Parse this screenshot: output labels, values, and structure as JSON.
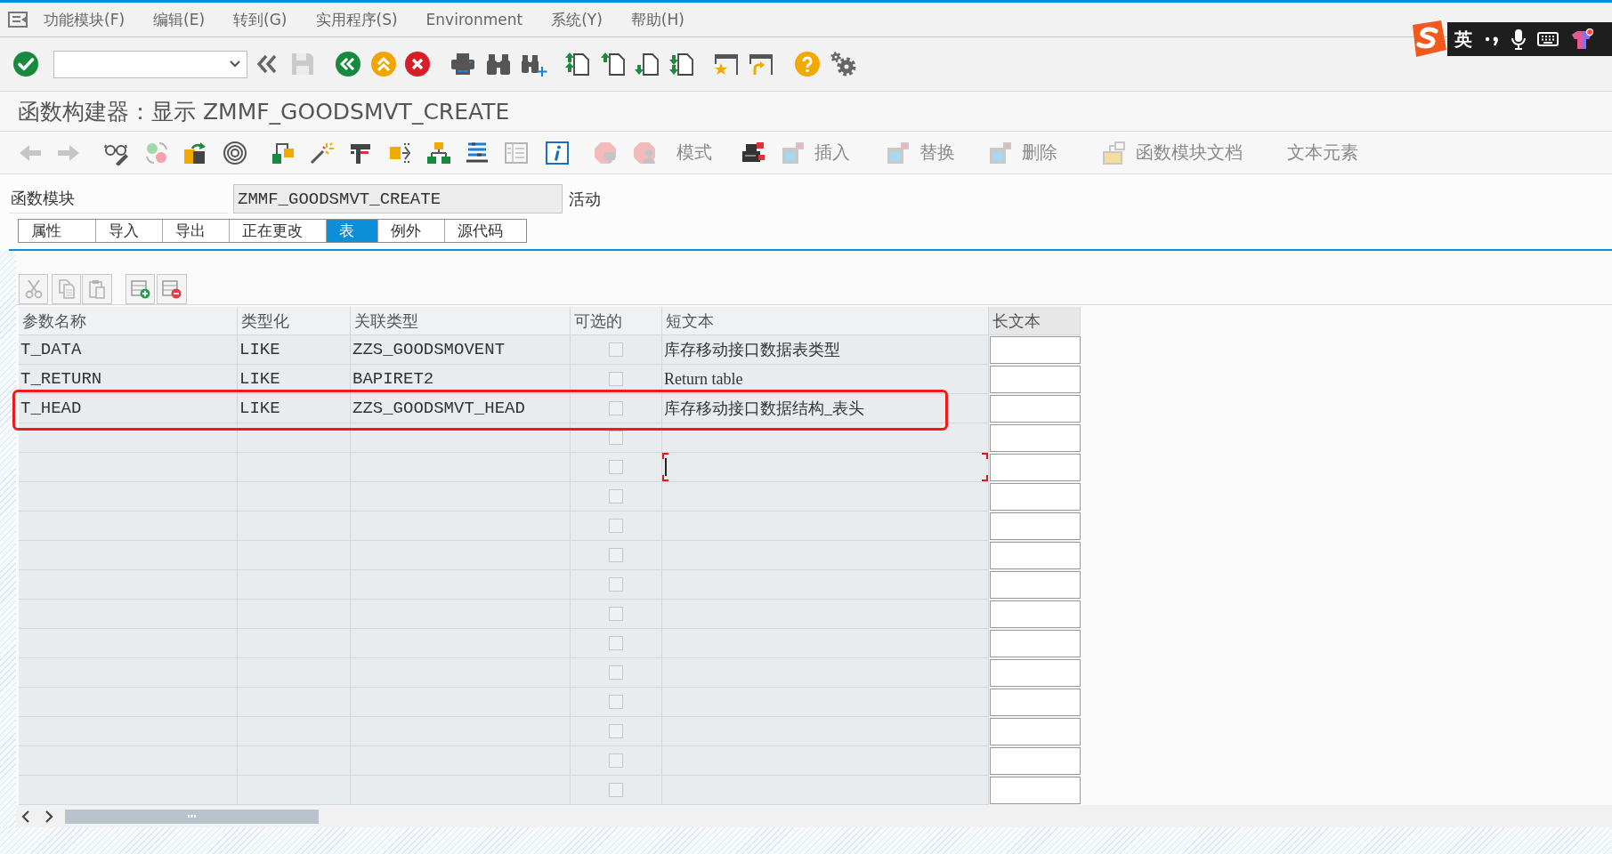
{
  "menu_bar": {
    "items": [
      "功能模块(F)",
      "编辑(E)",
      "转到(G)",
      "实用程序(S)",
      "Environment",
      "系统(Y)",
      "帮助(H)"
    ]
  },
  "title": "函数构建器：显示 ZMMF_GOODSMVT_CREATE",
  "app_toolbar": {
    "buttons": [
      {
        "label": "模式"
      },
      {
        "label": "插入"
      },
      {
        "label": "替换"
      },
      {
        "label": "删除"
      },
      {
        "label": "函数模块文档"
      },
      {
        "label": "文本元素"
      }
    ]
  },
  "function_module": {
    "label": "函数模块",
    "value": "ZMMF_GOODSMVT_CREATE",
    "status": "活动"
  },
  "tabs": [
    {
      "label": "属性",
      "selected": false
    },
    {
      "label": "导入",
      "selected": false
    },
    {
      "label": "导出",
      "selected": false
    },
    {
      "label": "正在更改",
      "selected": false
    },
    {
      "label": "表",
      "selected": true
    },
    {
      "label": "例外",
      "selected": false
    },
    {
      "label": "源代码",
      "selected": false
    }
  ],
  "table": {
    "columns": [
      "参数名称",
      "类型化",
      "关联类型",
      "可选的",
      "短文本",
      "长文本"
    ],
    "rows": [
      {
        "name": "T_DATA",
        "typing": "LIKE",
        "associated_type": "ZZS_GOODSMOVENT",
        "optional": false,
        "short_text": "库存移动接口数据表类型",
        "highlighted": false,
        "focused": false
      },
      {
        "name": "T_RETURN",
        "typing": "LIKE",
        "associated_type": "BAPIRET2",
        "optional": false,
        "short_text": "Return table",
        "highlighted": false,
        "focused": false
      },
      {
        "name": "T_HEAD",
        "typing": "LIKE",
        "associated_type": "ZZS_GOODSMVT_HEAD",
        "optional": false,
        "short_text": "库存移动接口数据结构_表头",
        "highlighted": true,
        "focused": false
      },
      {
        "optional": false,
        "highlighted": false,
        "focused": false
      },
      {
        "optional": false,
        "highlighted": false,
        "focused": true
      },
      {
        "optional": false,
        "highlighted": false,
        "focused": false
      },
      {
        "optional": false,
        "highlighted": false,
        "focused": false
      },
      {
        "optional": false,
        "highlighted": false,
        "focused": false
      },
      {
        "optional": false,
        "highlighted": false,
        "focused": false
      },
      {
        "optional": false,
        "highlighted": false,
        "focused": false
      },
      {
        "optional": false,
        "highlighted": false,
        "focused": false
      },
      {
        "optional": false,
        "highlighted": false,
        "focused": false
      },
      {
        "optional": false,
        "highlighted": false,
        "focused": false
      },
      {
        "optional": false,
        "highlighted": false,
        "focused": false
      },
      {
        "optional": false,
        "highlighted": false,
        "focused": false
      },
      {
        "optional": false,
        "highlighted": false,
        "focused": false
      }
    ]
  },
  "ime_bar": {
    "mode": "英"
  }
}
